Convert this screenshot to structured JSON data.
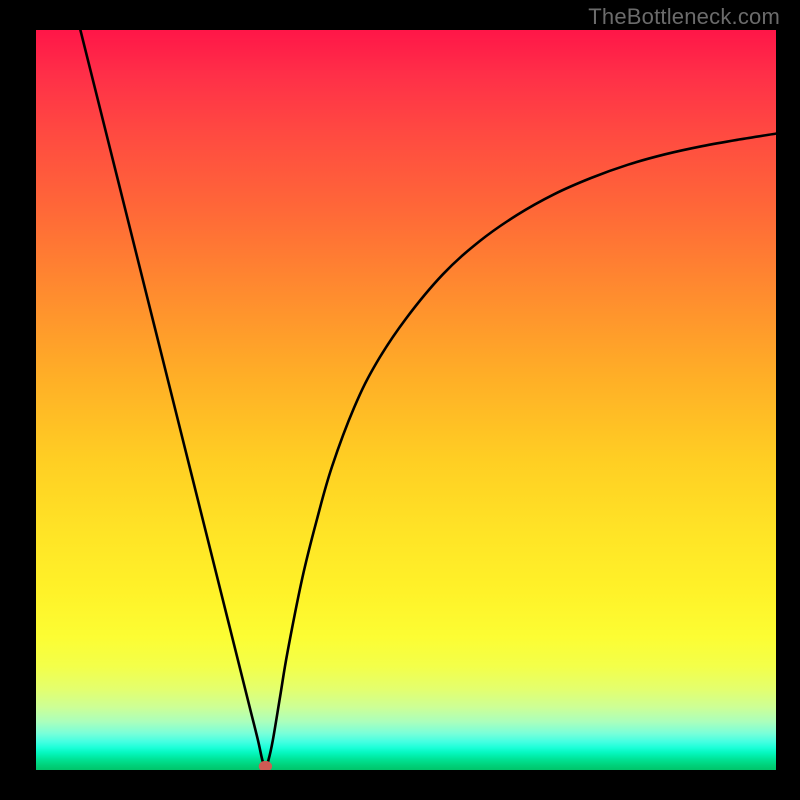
{
  "watermark": "TheBottleneck.com",
  "chart_data": {
    "type": "line",
    "title": "",
    "xlabel": "",
    "ylabel": "",
    "xlim": [
      0,
      100
    ],
    "ylim": [
      0,
      100
    ],
    "marker": {
      "x": 31,
      "y": 0.5,
      "color": "#cf5b54",
      "radius_pct": 0.9
    },
    "series": [
      {
        "name": "curve",
        "color": "#000000",
        "x": [
          6,
          8,
          10,
          12,
          14,
          16,
          18,
          20,
          22,
          24,
          26,
          28,
          29,
          30,
          30.6,
          31,
          31.4,
          32,
          33,
          34,
          36,
          38,
          40,
          43,
          46,
          50,
          55,
          60,
          65,
          70,
          75,
          80,
          85,
          90,
          95,
          100
        ],
        "values": [
          100,
          92,
          84,
          76,
          68,
          60,
          52,
          44,
          36,
          28,
          20,
          12,
          8,
          4,
          1.3,
          0.5,
          1.3,
          4,
          10,
          16,
          26,
          34,
          41,
          49,
          55,
          61,
          67,
          71.5,
          75,
          77.8,
          80,
          81.8,
          83.2,
          84.3,
          85.2,
          86
        ]
      }
    ]
  }
}
